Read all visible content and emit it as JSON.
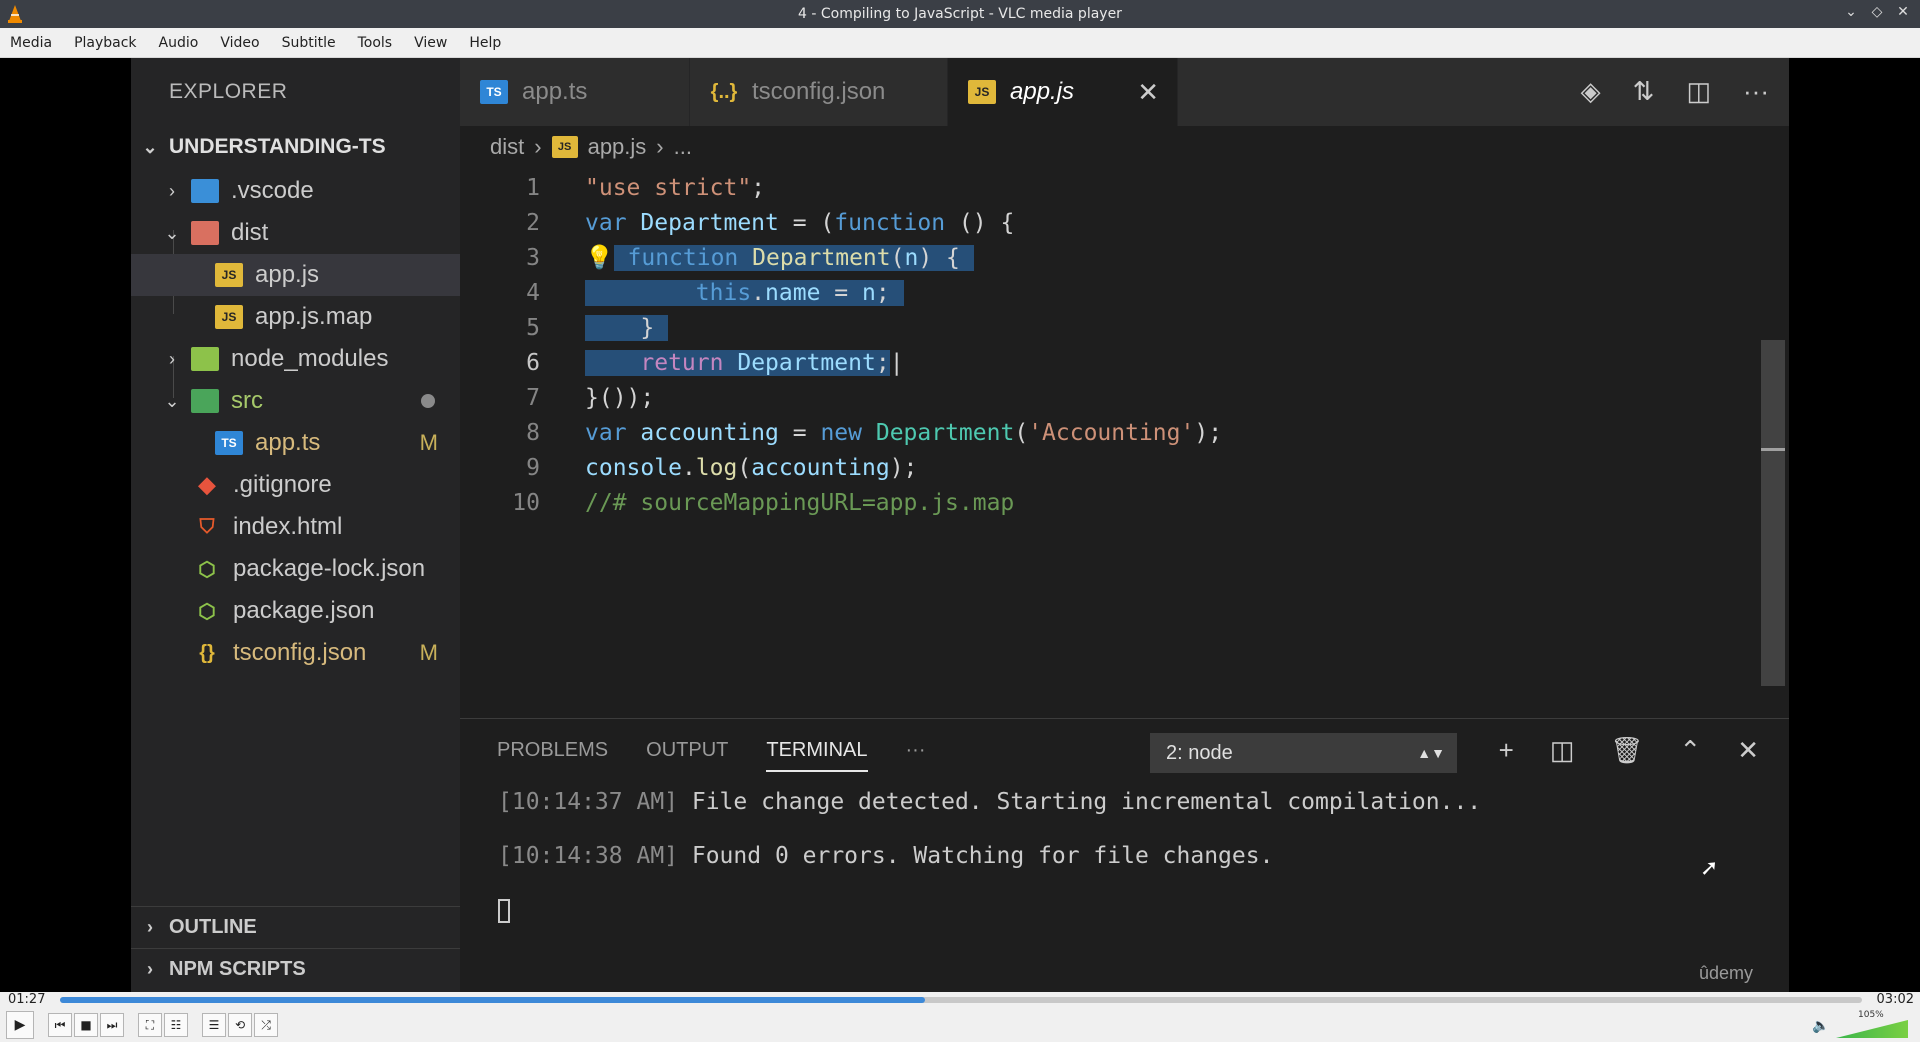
{
  "window": {
    "title": "4 - Compiling to JavaScript - VLC media player",
    "controls": [
      "⌄",
      "◇",
      "✕"
    ]
  },
  "menu": [
    "Media",
    "Playback",
    "Audio",
    "Video",
    "Subtitle",
    "Tools",
    "View",
    "Help"
  ],
  "explorer": {
    "header": "EXPLORER",
    "project": "UNDERSTANDING-TS",
    "items": [
      {
        "label": ".vscode",
        "badge": ""
      },
      {
        "label": "dist",
        "badge": ""
      },
      {
        "label": "app.js",
        "badge": ""
      },
      {
        "label": "app.js.map",
        "badge": ""
      },
      {
        "label": "node_modules",
        "badge": ""
      },
      {
        "label": "src",
        "badge": ""
      },
      {
        "label": "app.ts",
        "badge": "M"
      },
      {
        "label": ".gitignore",
        "badge": ""
      },
      {
        "label": "index.html",
        "badge": ""
      },
      {
        "label": "package-lock.json",
        "badge": ""
      },
      {
        "label": "package.json",
        "badge": ""
      },
      {
        "label": "tsconfig.json",
        "badge": "M"
      }
    ],
    "outline": "OUTLINE",
    "npm_scripts": "NPM SCRIPTS"
  },
  "tabs": [
    {
      "label": "app.ts",
      "icon": "TS"
    },
    {
      "label": "tsconfig.json",
      "icon": "{..}"
    },
    {
      "label": "app.js",
      "icon": "JS"
    }
  ],
  "icons": {
    "js": "JS",
    "ts": "TS"
  },
  "breadcrumb": {
    "folder": "dist",
    "file": "app.js",
    "more": "..."
  },
  "code": {
    "line_numbers": [
      "1",
      "2",
      "3",
      "4",
      "5",
      "6",
      "7",
      "8",
      "9",
      "10"
    ]
  },
  "panel": {
    "tabs": [
      "PROBLEMS",
      "OUTPUT",
      "TERMINAL",
      "···"
    ],
    "terminal_select": "2: node",
    "lines": [
      {
        "time": "[10:14:37 AM]",
        "text": " File change detected. Starting incremental compilation..."
      },
      {
        "time": "[10:14:38 AM]",
        "text": " Found 0 errors. Watching for file changes."
      }
    ],
    "watermark": "ûdemy"
  },
  "player": {
    "elapsed": "01:27",
    "total": "03:02",
    "progress": 0.48,
    "volume_label": "105%",
    "volume": 1.05,
    "seek_color": "#3d89d8"
  }
}
